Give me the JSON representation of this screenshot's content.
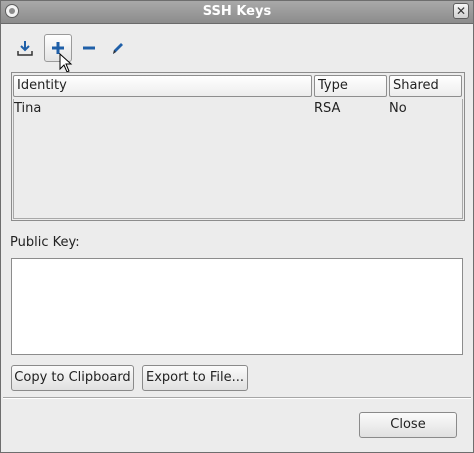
{
  "window": {
    "title": "SSH Keys"
  },
  "toolbar": {
    "import": {
      "icon": "download-icon"
    },
    "add": {
      "icon": "plus-icon"
    },
    "remove": {
      "icon": "minus-icon"
    },
    "edit": {
      "icon": "pencil-icon"
    }
  },
  "table": {
    "columns": [
      "Identity",
      "Type",
      "Shared"
    ],
    "rows": [
      {
        "identity": "Tina",
        "type": "RSA",
        "shared": "No"
      }
    ]
  },
  "public_key": {
    "label": "Public Key:",
    "value": ""
  },
  "buttons": {
    "copy": "Copy to Clipboard",
    "export": "Export to File...",
    "close": "Close"
  },
  "colors": {
    "accent": "#1f5fa8",
    "titlebar": "#9a9a9a"
  }
}
